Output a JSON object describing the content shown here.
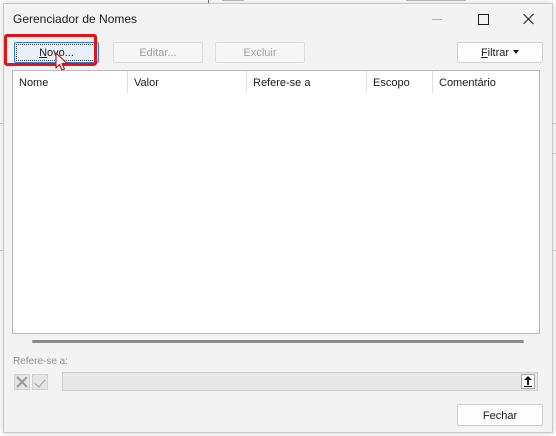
{
  "dialog": {
    "title": "Gerenciador de Nomes",
    "window_controls": [
      "minimize-icon",
      "maximize-icon",
      "close-icon"
    ]
  },
  "toolbar": {
    "new_label": "Novo...",
    "new_access_key": "N",
    "edit_label": "Editar...",
    "delete_label": "Excluir",
    "filter_label": "Filtrar",
    "filter_access_key": "F"
  },
  "names_list": {
    "columns": [
      "Nome",
      "Valor",
      "Refere-se a",
      "Escopo",
      "Comentário"
    ],
    "rows": []
  },
  "refers_to": {
    "label": "Refere-se a:",
    "value": ""
  },
  "footer": {
    "close_label": "Fechar"
  },
  "colors": {
    "highlight": "#e1141a",
    "default_button_border": "#2d7be0",
    "dialog_bg": "#f3f3f3"
  }
}
